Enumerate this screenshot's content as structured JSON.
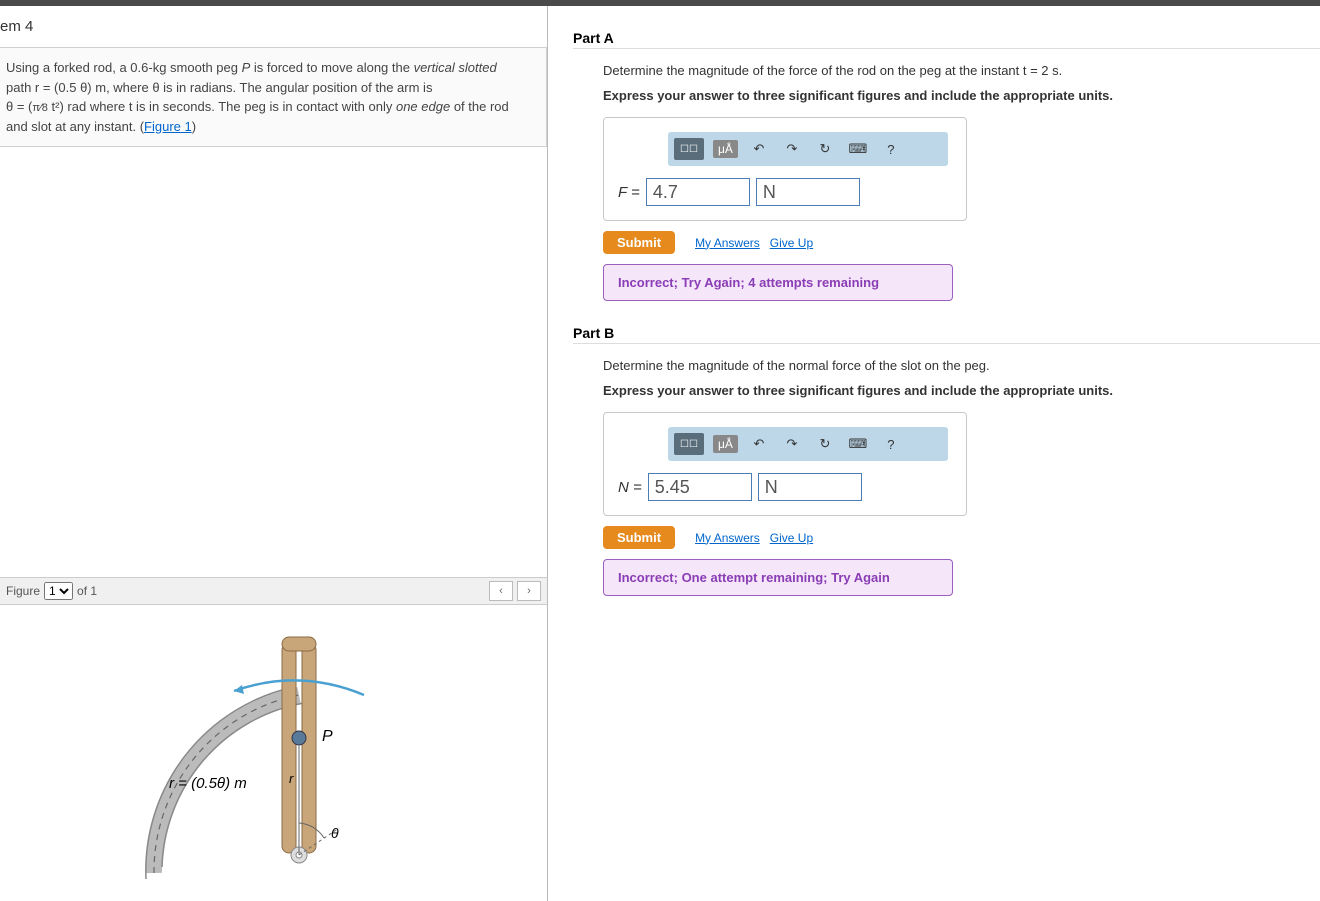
{
  "problem_title": "em 4",
  "description": {
    "line1_a": "Using a forked rod, a 0.6-",
    "line1_b": " smooth peg ",
    "line1_c": " is forced to move along the ",
    "line1_d": "vertical slotted",
    "line2": "path r = (0.5 θ) m, where θ is in radians. The angular position of the arm is",
    "line3_a": "θ = (",
    "line3_b": " t²) rad where t is in seconds. The peg is in contact with only ",
    "line3_c": "one edge",
    "line3_d": " of the rod",
    "line4_a": "and slot at any instant. (",
    "line4_b": "Figure 1",
    "line4_c": ")",
    "kg": "kg",
    "P": "P",
    "frac": "π⁄8"
  },
  "figure": {
    "selector_label": "Figure",
    "selected": "1",
    "of": "of 1",
    "eq_label": "r = (0.5θ) m",
    "P": "P",
    "r": "r",
    "theta": "θ"
  },
  "partA": {
    "header": "Part A",
    "question": "Determine the magnitude of the force of the rod on the peg at the instant t = 2 s.",
    "instruction": "Express your answer to three significant figures and include the appropriate units.",
    "label": "F = ",
    "value": "4.7",
    "unit": "N",
    "units_btn": "μÅ",
    "submit": "Submit",
    "my_answers": "My Answers",
    "give_up": "Give Up",
    "feedback": "Incorrect; Try Again; 4 attempts remaining"
  },
  "partB": {
    "header": "Part B",
    "question": "Determine the magnitude of the normal force of the slot on the peg.",
    "instruction": "Express your answer to three significant figures and include the appropriate units.",
    "label": "N = ",
    "value": "5.45",
    "unit": "N",
    "units_btn": "μÅ",
    "submit": "Submit",
    "my_answers": "My Answers",
    "give_up": "Give Up",
    "feedback": "Incorrect; One attempt remaining; Try Again"
  }
}
